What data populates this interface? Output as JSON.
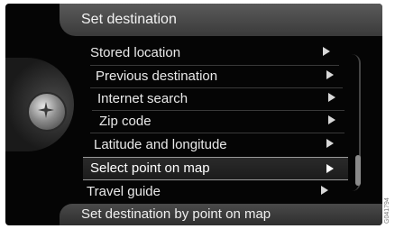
{
  "header": {
    "title": "Set destination"
  },
  "menu": {
    "items": [
      {
        "label": "Stored location"
      },
      {
        "label": "Previous destination"
      },
      {
        "label": "Internet search"
      },
      {
        "label": "Zip code"
      },
      {
        "label": "Latitude and longitude"
      },
      {
        "label": "Select point on map"
      },
      {
        "label": "Travel guide"
      }
    ],
    "selected_index": 5
  },
  "footer": {
    "text": "Set destination by point on map"
  },
  "image_code": "G041794",
  "colors": {
    "background": "#050505",
    "text": "#e9e9e9",
    "header": "#4a4a4a"
  },
  "icons": {
    "knob": "compass-knob-icon",
    "row": "play-arrow-icon"
  }
}
